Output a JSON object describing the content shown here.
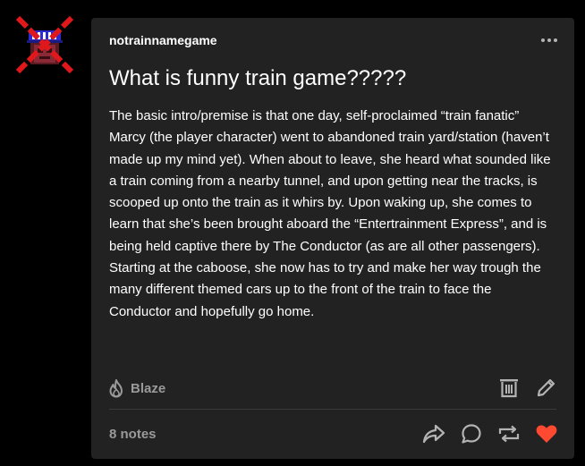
{
  "post": {
    "username": "notrainnamegame",
    "title": "What is funny train game?????",
    "body": "The basic intro/premise is that one day, self-proclaimed “train fanatic” Marcy (the player character) went to abandoned train yard/station (haven’t made up my mind yet). When about to leave, she heard what sounded like a train coming from a nearby tunnel, and upon getting near the tracks, is scooped up onto the train as it whirs by. Upon waking up, she comes to learn that she’s been brought aboard the “Entertrainment Express”, and is being held captive there by The Conductor (as are all other passengers). Starting at the caboose, she now has to try and make her way trough the many different themed cars up to the front of the train to face the Conductor and hopefully go home.",
    "more_label": "•••",
    "blaze_label": "Blaze",
    "notes_label": "8 notes"
  },
  "icons": {
    "avatar": "crossed-out-avatar",
    "more": "ellipsis-icon",
    "blaze": "flame-icon",
    "delete": "trash-icon",
    "edit": "pencil-icon",
    "share": "share-arrow-icon",
    "reply": "speech-bubble-icon",
    "reblog": "reblog-icon",
    "like": "heart-icon"
  },
  "colors": {
    "page_background": "#000000",
    "card_background": "#222222",
    "text_primary": "#ffffff",
    "text_secondary": "#9a9a9a",
    "like_active": "#ff4930",
    "avatar_cross": "#e0181c"
  }
}
